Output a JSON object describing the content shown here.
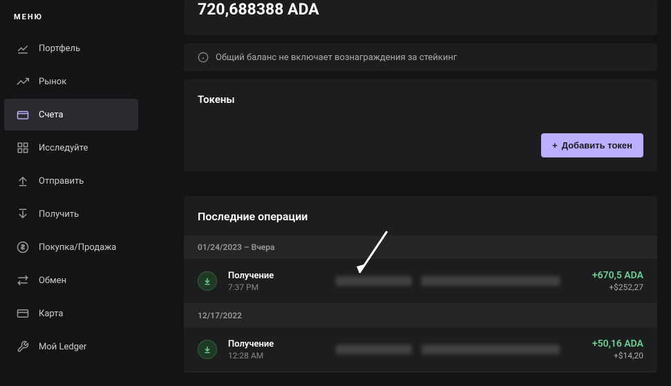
{
  "sidebar": {
    "header": "МЕНЮ",
    "items": [
      {
        "label": "Портфель",
        "icon": "chart-line-icon"
      },
      {
        "label": "Рынок",
        "icon": "trending-icon"
      },
      {
        "label": "Счета",
        "icon": "wallet-icon",
        "active": true
      },
      {
        "label": "Исследуйте",
        "icon": "grid-icon"
      },
      {
        "label": "Отправить",
        "icon": "upload-icon"
      },
      {
        "label": "Получить",
        "icon": "download-icon"
      },
      {
        "label": "Покупка/Продажа",
        "icon": "dollar-icon"
      },
      {
        "label": "Обмен",
        "icon": "swap-icon"
      },
      {
        "label": "Карта",
        "icon": "card-icon"
      },
      {
        "label": "Мой Ledger",
        "icon": "wrench-icon"
      }
    ]
  },
  "balance": {
    "value": "720,688388 ADA"
  },
  "notice": {
    "text": "Общий баланс не включает вознаграждения за стейкинг"
  },
  "tokens": {
    "title": "Токены",
    "add_label": "Добавить токен"
  },
  "operations": {
    "title": "Последние операции",
    "groups": [
      {
        "date": "01/24/2023 – Вчера",
        "rows": [
          {
            "type": "Получение",
            "time": "7:37 PM",
            "crypto": "+670,5 ADA",
            "fiat": "+$252,27"
          }
        ]
      },
      {
        "date": "12/17/2022",
        "rows": [
          {
            "type": "Получение",
            "time": "12:28 AM",
            "crypto": "+50,16 ADA",
            "fiat": "+$14,20"
          }
        ]
      }
    ]
  }
}
